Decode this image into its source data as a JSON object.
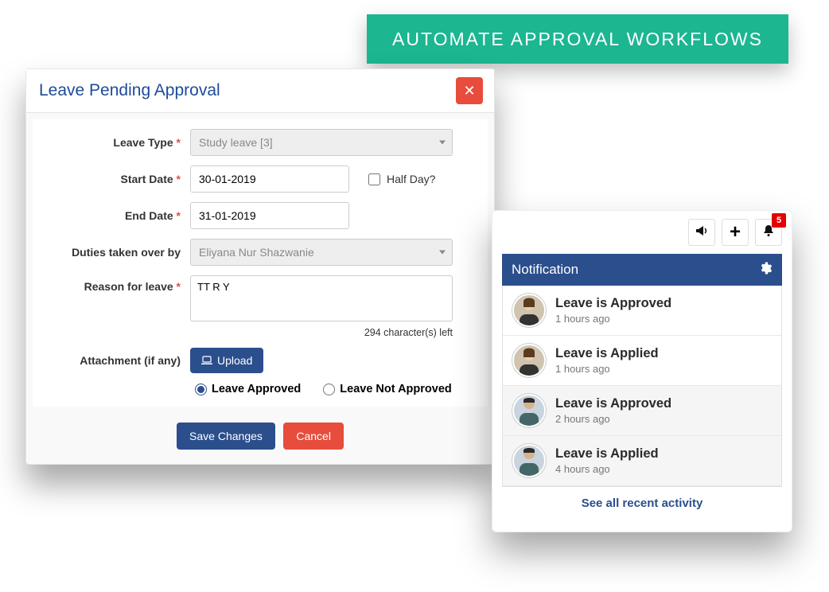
{
  "banner": {
    "text": "AUTOMATE APPROVAL WORKFLOWS"
  },
  "modal": {
    "title": "Leave Pending Approval",
    "labels": {
      "leaveType": "Leave Type",
      "startDate": "Start Date",
      "endDate": "End Date",
      "duties": "Duties taken over by",
      "reason": "Reason for leave",
      "attachment": "Attachment (if any)",
      "halfDay": "Half Day?"
    },
    "values": {
      "leaveType": "Study leave [3]",
      "startDate": "30-01-2019",
      "endDate": "31-01-2019",
      "duties": "Eliyana Nur Shazwanie",
      "reason": "TT R Y",
      "charsLeft": "294 character(s) left"
    },
    "buttons": {
      "upload": "Upload",
      "save": "Save Changes",
      "cancel": "Cancel"
    },
    "radios": {
      "approved": "Leave Approved",
      "notApproved": "Leave Not Approved"
    }
  },
  "notif": {
    "header": "Notification",
    "badge": "5",
    "items": [
      {
        "title": "Leave is Approved",
        "time": "1 hours ago",
        "avatar": "female"
      },
      {
        "title": "Leave is Applied",
        "time": "1 hours ago",
        "avatar": "female"
      },
      {
        "title": "Leave is Approved",
        "time": "2 hours ago",
        "avatar": "male"
      },
      {
        "title": "Leave is Applied",
        "time": "4 hours ago",
        "avatar": "male"
      }
    ],
    "footer": "See all recent activity"
  }
}
